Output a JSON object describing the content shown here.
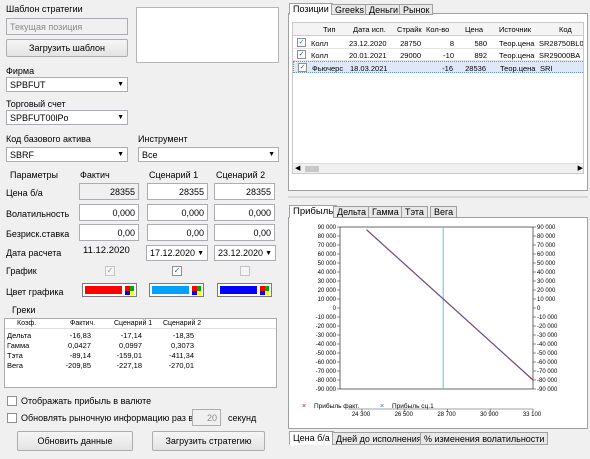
{
  "left": {
    "template_label": "Шаблон стратегии",
    "template_placeholder": "Текущая позиция",
    "load_template": "Загрузить шаблон",
    "firm_label": "Фирма",
    "firm_value": "SPBFUT",
    "account_label": "Торговый счет",
    "account_value": "SPBFUT00lPo",
    "base_asset_label": "Код базового актива",
    "base_asset_value": "SBRF",
    "instrument_label": "Инструмент",
    "instrument_value": "Все",
    "params": {
      "header": "Параметры",
      "col_fact": "Фактич",
      "col_s1": "Сценарий 1",
      "col_s2": "Сценарий 2",
      "price_label": "Цена б/а",
      "price_fact": "28355",
      "price_s1": "28355",
      "price_s2": "28355",
      "vol_label": "Волатильность",
      "vol_fact": "0,000",
      "vol_s1": "0,000",
      "vol_s2": "0,000",
      "rate_label": "Безриск.ставка",
      "rate_fact": "0,00",
      "rate_s1": "0,00",
      "rate_s2": "0,00",
      "date_label": "Дата расчета",
      "date_fact": "11.12.2020",
      "date_s1": "17.12.2020",
      "date_s2": "23.12.2020",
      "chart_label": "График",
      "color_label": "Цвет графика",
      "color_fact": "#ff0000",
      "color_s1": "#00a2ff",
      "color_s2": "#0000ff"
    },
    "greeks": {
      "title": "Греки",
      "headers": [
        "Коэф.",
        "Фактич.",
        "Сценарий 1",
        "Сценарий 2"
      ],
      "rows": [
        [
          "Дельта",
          "-16,83",
          "-17,14",
          "-18,35"
        ],
        [
          "Гамма",
          "0,0427",
          "0,0997",
          "0,3073"
        ],
        [
          "Тэта",
          "-89,14",
          "-159,01",
          "-411,34"
        ],
        [
          "Вега",
          "-209,85",
          "-227,18",
          "-270,01"
        ]
      ]
    },
    "show_currency": "Отображать прибыль в валюте",
    "refresh_label": "Обновлять рыночную информацию раз в",
    "refresh_value": "20",
    "refresh_unit": "секунд",
    "update_data": "Обновить данные",
    "load_strategy": "Загрузить стратегию"
  },
  "positions": {
    "tabs": [
      "Позиции",
      "Greeks",
      "Деньги",
      "Рынок"
    ],
    "headers": [
      "Тип",
      "Дата исп.",
      "Страйк",
      "Кол-во",
      "Цена",
      "Источник",
      "Код"
    ],
    "rows": [
      {
        "type": "Колл",
        "date": "23.12.2020",
        "strike": "28750",
        "qty": "8",
        "price": "580",
        "source": "Теор.цена",
        "code": "SR28750BL0"
      },
      {
        "type": "Колл",
        "date": "20.01.2021",
        "strike": "29000",
        "qty": "-10",
        "price": "892",
        "source": "Теор.цена",
        "code": "SR29000BA"
      },
      {
        "type": "Фьючерс",
        "date": "18.03.2021",
        "strike": "",
        "qty": "-16",
        "price": "28536",
        "source": "Теор.цена",
        "code": "SRI"
      }
    ]
  },
  "chart_tabs": [
    "Прибыль",
    "Дельта",
    "Гамма",
    "Тэта",
    "Вега"
  ],
  "bottom_tabs": [
    "Цена б/а",
    "Дней до исполнения",
    "% изменения волатильности"
  ],
  "chart_data": {
    "type": "line",
    "series": [
      {
        "name": "Прибыль факт.",
        "color": "#c00000",
        "x": [
          24300,
          33100
        ],
        "y": [
          87000,
          -80000
        ]
      },
      {
        "name": "Прибыль сц.1",
        "color": "#2e6fd8",
        "x": [
          24300,
          33100
        ],
        "y": [
          87000,
          -80000
        ]
      }
    ],
    "xlim": [
      22900,
      33100
    ],
    "ylim": [
      -90000,
      90000
    ],
    "xticks": [
      "24 300",
      "26 500",
      "28 700",
      "30 900",
      "33 100"
    ],
    "yticks": [
      "90 000",
      "80 000",
      "70 000",
      "60 000",
      "50 000",
      "40 000",
      "30 000",
      "20 000",
      "10 000",
      "0",
      "-10 000",
      "-20 000",
      "-30 000",
      "-40 000",
      "-50 000",
      "-60 000",
      "-70 000",
      "-80 000",
      "-90 000"
    ],
    "yticks_right": [
      "90 000",
      "80 000",
      "70 000",
      "60 000",
      "50 000",
      "40 000",
      "30 000",
      "20 000",
      "10 000",
      "0",
      "-10 000",
      "-20 000",
      "-30 000",
      "-40 000",
      "-50 000",
      "-60 000",
      "-70 000",
      "-80 000",
      "-90 000"
    ],
    "current_price": 28355,
    "legend_marker_1": "×",
    "legend_marker_2": "×"
  }
}
